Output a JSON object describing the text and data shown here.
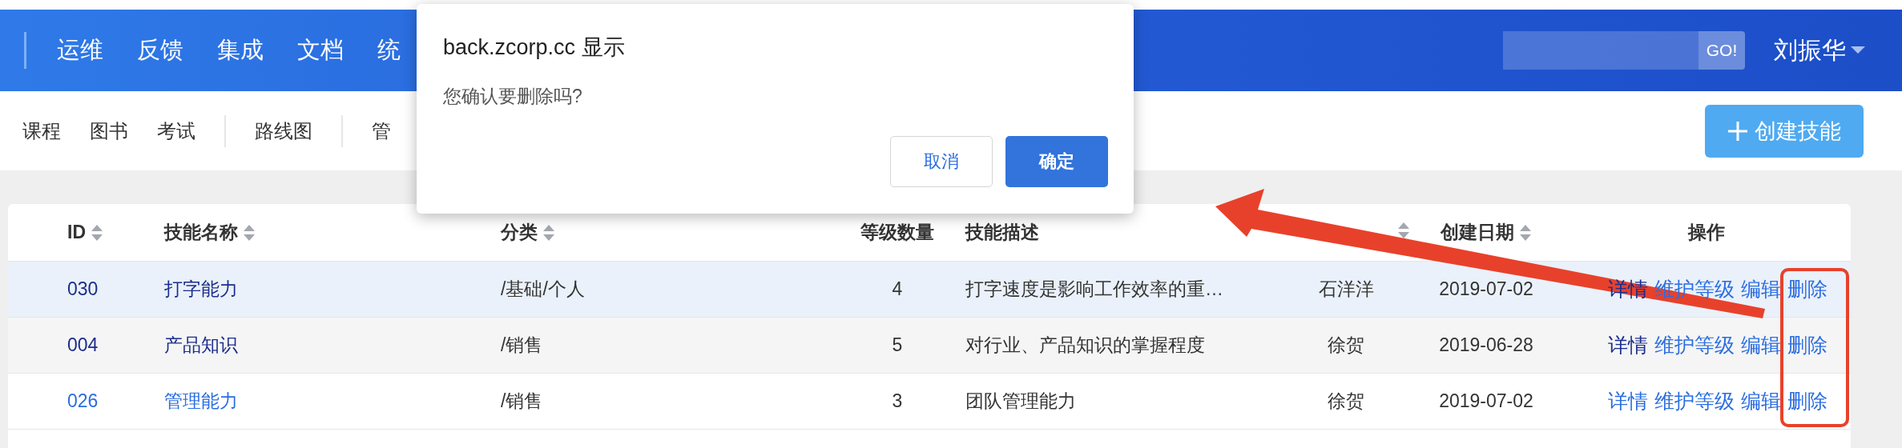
{
  "nav": {
    "items": [
      {
        "label": "运维"
      },
      {
        "label": "反馈"
      },
      {
        "label": "集成"
      },
      {
        "label": "文档"
      },
      {
        "label": "统"
      }
    ],
    "search": {
      "button": "GO!"
    },
    "user": "刘振华"
  },
  "subnav": {
    "groups": [
      [
        "课程",
        "图书",
        "考试"
      ],
      [
        "路线图"
      ],
      [
        "管"
      ]
    ]
  },
  "create_button": {
    "label": "创建技能"
  },
  "table": {
    "columns": [
      {
        "label": "ID",
        "sortable": true
      },
      {
        "label": "技能名称",
        "sortable": true
      },
      {
        "label": "分类",
        "sortable": true
      },
      {
        "label": "等级数量",
        "sortable": false
      },
      {
        "label": "技能描述",
        "sortable": false
      },
      {
        "sortable": true
      },
      {
        "label": "创建日期",
        "sortable": true
      },
      {
        "label": "操作",
        "sortable": false
      }
    ],
    "rows": [
      {
        "hovered": true,
        "visited": true,
        "cells": [
          "030",
          "打字能力",
          "/基础/个人",
          "4",
          "打字速度是影响工作效率的重…",
          "石洋洋",
          "2019-07-02"
        ],
        "actions": [
          "详情",
          "维护等级",
          "编辑",
          "删除"
        ]
      },
      {
        "hovered": false,
        "visited": true,
        "cells": [
          "004",
          "产品知识",
          "/销售",
          "5",
          "对行业、产品知识的掌握程度",
          "徐贺",
          "2019-06-28"
        ],
        "actions": [
          "详情",
          "维护等级",
          "编辑",
          "删除"
        ]
      },
      {
        "hovered": false,
        "visited": false,
        "cells": [
          "026",
          "管理能力",
          "/销售",
          "3",
          "团队管理能力",
          "徐贺",
          "2019-07-02"
        ],
        "actions": [
          "详情",
          "维护等级",
          "编辑",
          "删除"
        ]
      }
    ]
  },
  "dialog": {
    "title": "back.zcorp.cc 显示",
    "message": "您确认要删除吗?",
    "buttons": [
      {
        "label": "取消",
        "kind": "secondary"
      },
      {
        "label": "确定",
        "kind": "primary"
      }
    ]
  }
}
